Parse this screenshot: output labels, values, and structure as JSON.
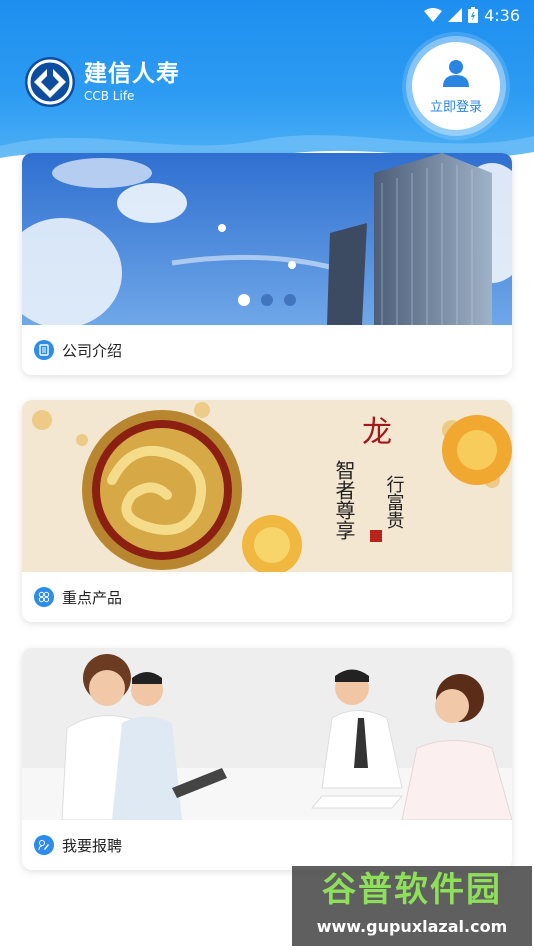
{
  "status_bar": {
    "time": "4:36"
  },
  "header": {
    "brand_cn": "建信人寿",
    "brand_en": "CCB Life",
    "login_label": "立即登录"
  },
  "cards": [
    {
      "label": "公司介绍",
      "icon": "document-icon"
    },
    {
      "label": "重点产品",
      "icon": "product-grid-icon"
    },
    {
      "label": "我要报聘",
      "icon": "edit-icon"
    }
  ],
  "banner_text": {
    "line1": "龙",
    "line2": "行富贵",
    "line3": "智者尊享"
  },
  "carousel": {
    "count": 3,
    "active_index": 0
  },
  "watermark": {
    "title": "谷普软件园",
    "url": "www.gupuxlazal.com"
  },
  "colors": {
    "primary": "#1e8ff0",
    "accent": "#2c8ce8"
  }
}
